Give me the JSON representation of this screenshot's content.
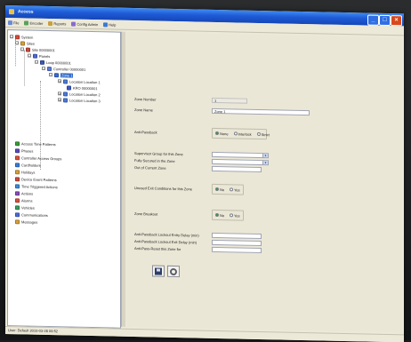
{
  "window": {
    "title": "Access",
    "buttons": {
      "minimize": "_",
      "maximize": "□",
      "close": "×"
    }
  },
  "menu": [
    {
      "label": "File",
      "icon": "file-icon",
      "color": "#6a8ad8"
    },
    {
      "label": "Encoder",
      "icon": "encoder-icon",
      "color": "#5aa05a"
    },
    {
      "label": "Reports",
      "icon": "reports-icon",
      "color": "#c8a040"
    },
    {
      "label": "Config Admin",
      "icon": "config-icon",
      "color": "#8a6ad0"
    },
    {
      "label": "Help",
      "icon": "help-icon",
      "color": "#3a7ad8"
    }
  ],
  "tree": {
    "nodes": [
      {
        "label": "System",
        "icon": "system-icon",
        "color": "#d84a3a",
        "expander": "-"
      },
      {
        "label": "Sites",
        "icon": "sites-icon",
        "color": "#d8a03a",
        "expander": "-"
      },
      {
        "label": "Site 00000001",
        "icon": "site-icon",
        "color": "#c84a3a",
        "expander": "-"
      },
      {
        "label": "Panels",
        "icon": "panels-icon",
        "color": "#4a6ad8",
        "expander": "-"
      },
      {
        "label": "Loop 00000001",
        "icon": "loop-icon",
        "color": "#3a5ab8",
        "expander": "-"
      },
      {
        "label": "Controller 00000001",
        "icon": "controller-icon",
        "color": "#5a7ad8",
        "expander": "-"
      },
      {
        "label": "Zone 1",
        "icon": "zone-icon",
        "color": "#3a6ad8",
        "expander": "-",
        "selected": true
      },
      {
        "label": "Location Location 1",
        "icon": "location-icon",
        "color": "#4a7ad8",
        "expander": "+"
      },
      {
        "label": "KRO 00000001",
        "icon": "device-icon",
        "color": "#3a5ac8",
        "expander": ""
      },
      {
        "label": "Location Location 2",
        "icon": "location-icon",
        "color": "#4a7ad8",
        "expander": "+"
      },
      {
        "label": "Location Location 3",
        "icon": "location-icon",
        "color": "#4a7ad8",
        "expander": "+"
      },
      {
        "label": "Access Time Patterns",
        "icon": "time-pattern-icon",
        "color": "#3a9a3a",
        "expander": ""
      },
      {
        "label": "Phases",
        "icon": "phases-icon",
        "color": "#5a4ab8",
        "expander": ""
      },
      {
        "label": "Controller Access Groups",
        "icon": "access-groups-icon",
        "color": "#d8503a",
        "expander": ""
      },
      {
        "label": "Cardholders",
        "icon": "cardholders-icon",
        "color": "#3a7ad8",
        "expander": ""
      },
      {
        "label": "Holidays",
        "icon": "holidays-icon",
        "color": "#d8a03a",
        "expander": ""
      },
      {
        "label": "Device Event Patterns",
        "icon": "event-patterns-icon",
        "color": "#c84a3a",
        "expander": ""
      },
      {
        "label": "Time Triggered Actions",
        "icon": "timed-actions-icon",
        "color": "#3a8ad8",
        "expander": ""
      },
      {
        "label": "Actions",
        "icon": "actions-icon",
        "color": "#8a4ab8",
        "expander": ""
      },
      {
        "label": "Alarms",
        "icon": "alarms-icon",
        "color": "#d8503a",
        "expander": ""
      },
      {
        "label": "Vehicles",
        "icon": "vehicles-icon",
        "color": "#3a9a5a",
        "expander": ""
      },
      {
        "label": "Communications",
        "icon": "communications-icon",
        "color": "#4a6ad8",
        "expander": ""
      },
      {
        "label": "Messages",
        "icon": "messages-icon",
        "color": "#d8a03a",
        "expander": ""
      }
    ]
  },
  "form": {
    "zone_number_label": "Zone Number",
    "zone_number_value": "1",
    "zone_name_label": "Zone Name",
    "zone_name_value": "Zone 1",
    "anti_passback_label": "Anti-Passback",
    "anti_passback_options": [
      "None",
      "Interlock",
      "Strict"
    ],
    "supervisor_group_label": "Supervisor Group for this Zone",
    "fully_secured_label": "Fully Secured in the Zone",
    "out_of_zone_label": "Out of Current Zone",
    "unused_exit_label": "Unused Exit Conditions for this Zone",
    "unused_exit_options": [
      "No",
      "Yes"
    ],
    "zone_breakout_label": "Zone Breakout",
    "zone_breakout_options": [
      "No",
      "Yes"
    ],
    "lockout_entry_label": "Anti-Passback Lockout Entry Delay (min)",
    "lockout_exit_label": "Anti-Passback Lockout Exit Delay (min)",
    "anti_passback_reset_label": "Anti-Pass-Reset this Zone for"
  },
  "status": {
    "text": "User: Default 2010-03-28 09:52"
  }
}
